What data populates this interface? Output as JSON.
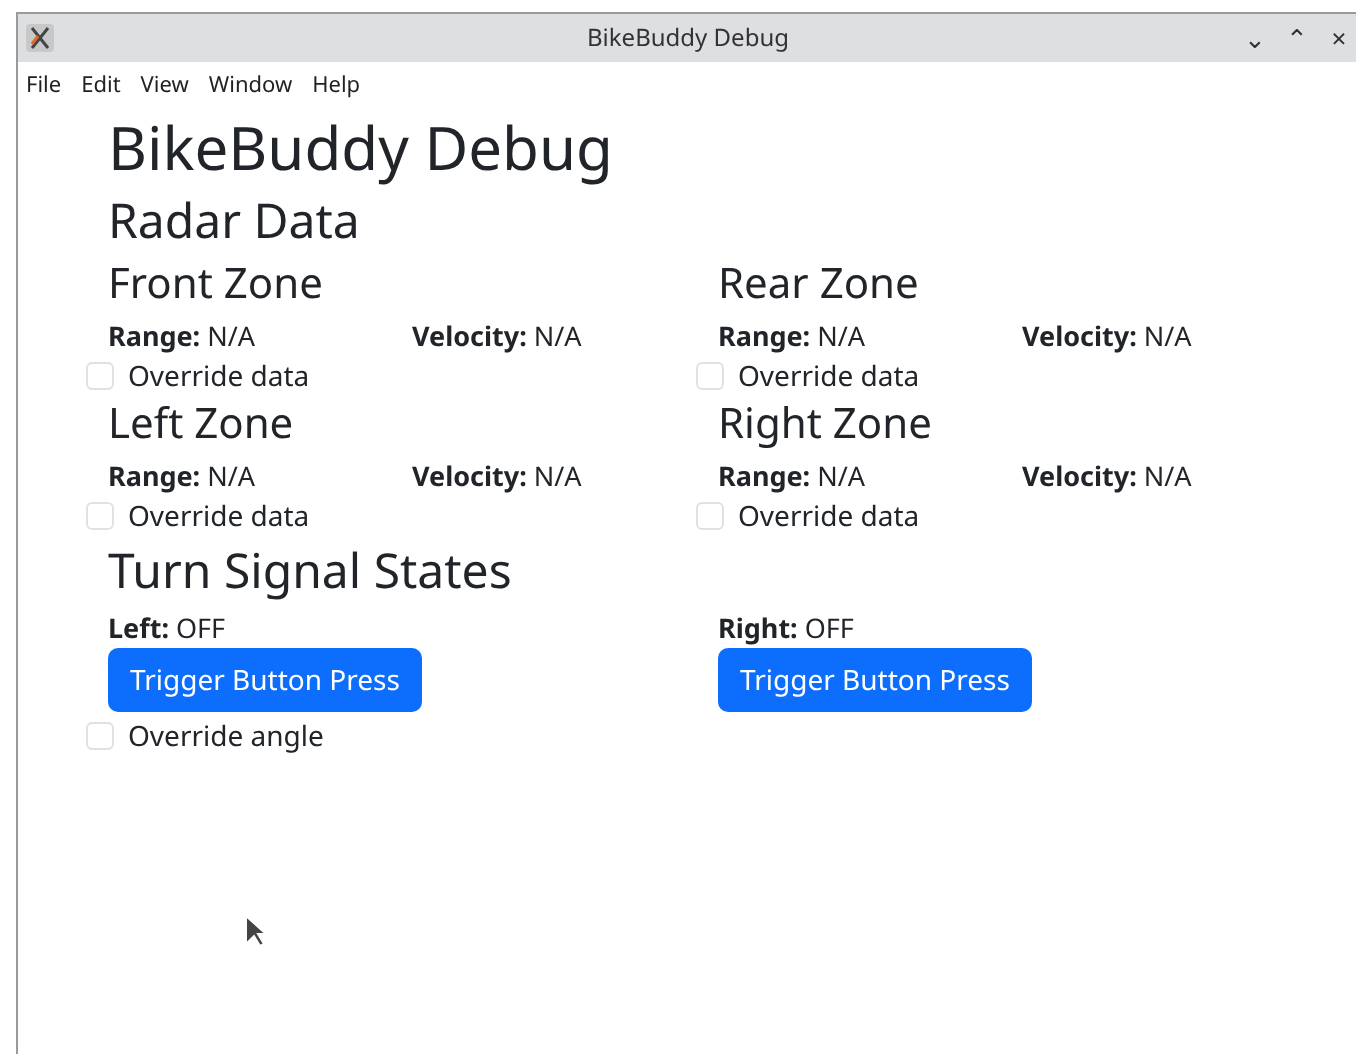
{
  "window": {
    "title": "BikeBuddy Debug",
    "controls": [
      "⌄",
      "⌃",
      "×"
    ]
  },
  "menu": [
    "File",
    "Edit",
    "View",
    "Window",
    "Help"
  ],
  "heading": "BikeBuddy Debug",
  "radar": {
    "title": "Radar Data",
    "zones": [
      {
        "name": "Front Zone",
        "range": "**Range:** N/A",
        "velocity": "**Velocity:** N/A",
        "override": {
          "label": "Override data",
          "checked": false
        }
      },
      {
        "name": "Rear Zone",
        "range": "**Range:** N/A",
        "velocity": "**Velocity:** N/A",
        "override": {
          "label": "Override data",
          "checked": false
        }
      },
      {
        "name": "Left Zone",
        "range": "**Range:** N/A",
        "velocity": "**Velocity:** N/A",
        "override": {
          "label": "Override data",
          "checked": false
        }
      },
      {
        "name": "Right Zone",
        "range": "**Range:** N/A",
        "velocity": "**Velocity:** N/A",
        "override": {
          "label": "Override data",
          "checked": false
        }
      }
    ]
  },
  "turn_signals": {
    "title": "Turn Signal States",
    "signals": [
      {
        "state": "**Left:** OFF",
        "button": "Trigger Button Press"
      },
      {
        "state": "**Right:** OFF",
        "button": "Trigger Button Press"
      }
    ],
    "override": {
      "label": "Override angle",
      "checked": false
    }
  }
}
